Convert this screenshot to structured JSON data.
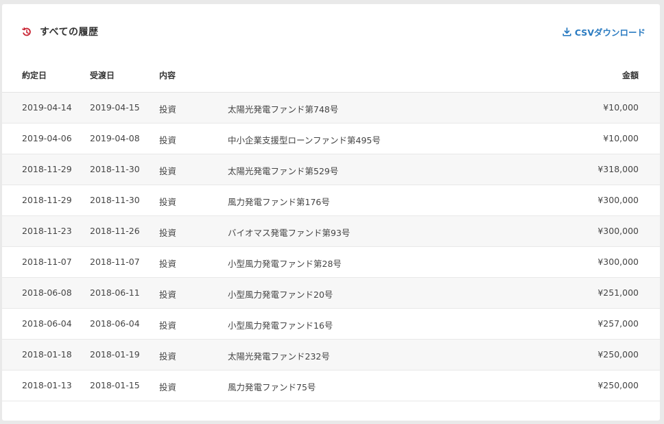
{
  "header": {
    "title": "すべての履歴",
    "csv_label": "CSVダウンロード",
    "title_icon": "history-icon",
    "csv_icon": "download-icon",
    "accent_color": "#c8202f",
    "link_color": "#2a7bc1"
  },
  "table": {
    "columns": {
      "contract_date": "約定日",
      "delivery_date": "受渡日",
      "type": "内容",
      "amount": "金額"
    },
    "rows": [
      {
        "contract_date": "2019-04-14",
        "delivery_date": "2019-04-15",
        "type": "投資",
        "fund": "太陽光発電ファンド第748号",
        "amount": "¥10,000"
      },
      {
        "contract_date": "2019-04-06",
        "delivery_date": "2019-04-08",
        "type": "投資",
        "fund": "中小企業支援型ローンファンド第495号",
        "amount": "¥10,000"
      },
      {
        "contract_date": "2018-11-29",
        "delivery_date": "2018-11-30",
        "type": "投資",
        "fund": "太陽光発電ファンド第529号",
        "amount": "¥318,000"
      },
      {
        "contract_date": "2018-11-29",
        "delivery_date": "2018-11-30",
        "type": "投資",
        "fund": "風力発電ファンド第176号",
        "amount": "¥300,000"
      },
      {
        "contract_date": "2018-11-23",
        "delivery_date": "2018-11-26",
        "type": "投資",
        "fund": "バイオマス発電ファンド第93号",
        "amount": "¥300,000"
      },
      {
        "contract_date": "2018-11-07",
        "delivery_date": "2018-11-07",
        "type": "投資",
        "fund": "小型風力発電ファンド第28号",
        "amount": "¥300,000"
      },
      {
        "contract_date": "2018-06-08",
        "delivery_date": "2018-06-11",
        "type": "投資",
        "fund": "小型風力発電ファンド20号",
        "amount": "¥251,000"
      },
      {
        "contract_date": "2018-06-04",
        "delivery_date": "2018-06-04",
        "type": "投資",
        "fund": "小型風力発電ファンド16号",
        "amount": "¥257,000"
      },
      {
        "contract_date": "2018-01-18",
        "delivery_date": "2018-01-19",
        "type": "投資",
        "fund": "太陽光発電ファンド232号",
        "amount": "¥250,000"
      },
      {
        "contract_date": "2018-01-13",
        "delivery_date": "2018-01-15",
        "type": "投資",
        "fund": "風力発電ファンド75号",
        "amount": "¥250,000"
      }
    ]
  }
}
